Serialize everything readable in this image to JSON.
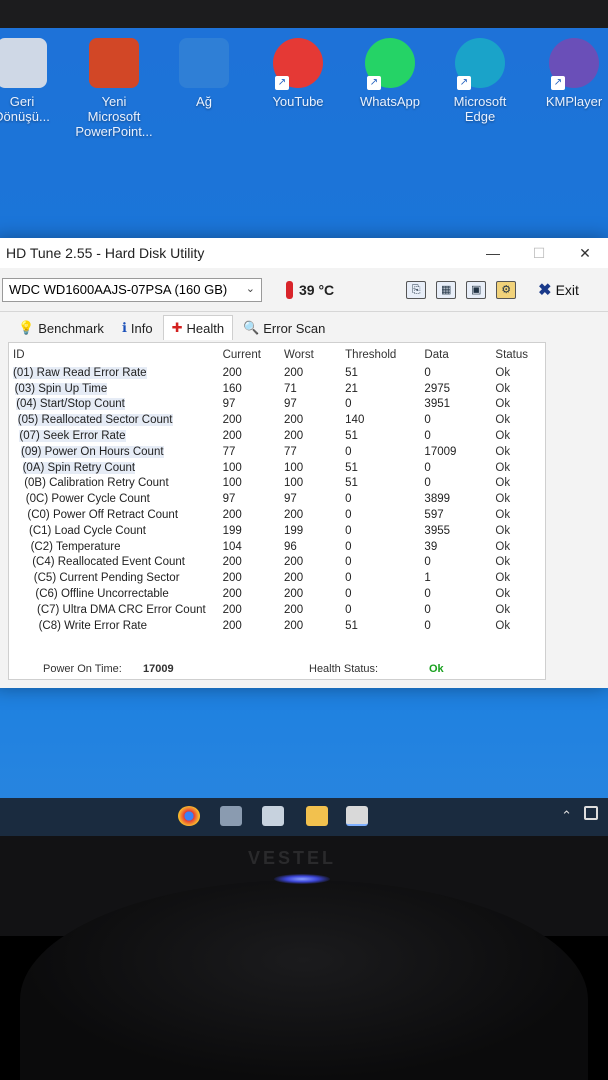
{
  "desktop_icons": [
    {
      "name": "recycle-bin",
      "label": "Geri\nDönüşü...",
      "color": "#cfd8e6"
    },
    {
      "name": "powerpoint-file",
      "label": "Yeni Microsoft\nPowerPoint...",
      "color": "#d24726"
    },
    {
      "name": "network",
      "label": "Ağ",
      "color": "#2f7fd6"
    },
    {
      "name": "youtube-shortcut",
      "label": "YouTube",
      "color": "#e53935"
    },
    {
      "name": "whatsapp-shortcut",
      "label": "WhatsApp",
      "color": "#25d366"
    },
    {
      "name": "edge-shortcut",
      "label": "Microsoft\nEdge",
      "color": "#1aa3c9"
    },
    {
      "name": "kmplayer-shortcut",
      "label": "KMPlayer",
      "color": "#6a4fb8"
    }
  ],
  "window": {
    "title": "HD Tune 2.55 - Hard Disk Utility",
    "minimize": "—",
    "maximize": "☐",
    "close": "✕"
  },
  "toolbar": {
    "drive": "WDC   WD1600AAJS-07PSA (160 GB)",
    "temperature": "39 °C",
    "exit_label": "Exit"
  },
  "tabs": [
    {
      "label": "Benchmark",
      "icon": "benchmark-icon"
    },
    {
      "label": "Info",
      "icon": "info-icon"
    },
    {
      "label": "Health",
      "icon": "health-icon",
      "active": true
    },
    {
      "label": "Error Scan",
      "icon": "error-scan-icon"
    }
  ],
  "table": {
    "headers": [
      "ID",
      "Current",
      "Worst",
      "Threshold",
      "Data",
      "Status"
    ],
    "rows": [
      [
        "(01) Raw Read Error Rate",
        "200",
        "200",
        "51",
        "0",
        "Ok"
      ],
      [
        "(03) Spin Up Time",
        "160",
        "71",
        "21",
        "2975",
        "Ok"
      ],
      [
        "(04) Start/Stop Count",
        "97",
        "97",
        "0",
        "3951",
        "Ok"
      ],
      [
        "(05) Reallocated Sector Count",
        "200",
        "200",
        "140",
        "0",
        "Ok"
      ],
      [
        "(07) Seek Error Rate",
        "200",
        "200",
        "51",
        "0",
        "Ok"
      ],
      [
        "(09) Power On Hours Count",
        "77",
        "77",
        "0",
        "17009",
        "Ok"
      ],
      [
        "(0A) Spin Retry Count",
        "100",
        "100",
        "51",
        "0",
        "Ok"
      ],
      [
        "(0B) Calibration Retry Count",
        "100",
        "100",
        "51",
        "0",
        "Ok"
      ],
      [
        "(0C) Power Cycle Count",
        "97",
        "97",
        "0",
        "3899",
        "Ok"
      ],
      [
        "(C0) Power Off Retract Count",
        "200",
        "200",
        "0",
        "597",
        "Ok"
      ],
      [
        "(C1) Load Cycle Count",
        "199",
        "199",
        "0",
        "3955",
        "Ok"
      ],
      [
        "(C2) Temperature",
        "104",
        "96",
        "0",
        "39",
        "Ok"
      ],
      [
        "(C4) Reallocated Event Count",
        "200",
        "200",
        "0",
        "0",
        "Ok"
      ],
      [
        "(C5) Current Pending Sector",
        "200",
        "200",
        "0",
        "1",
        "Ok"
      ],
      [
        "(C6) Offline Uncorrectable",
        "200",
        "200",
        "0",
        "0",
        "Ok"
      ],
      [
        "(C7) Ultra DMA CRC Error Count",
        "200",
        "200",
        "0",
        "0",
        "Ok"
      ],
      [
        "(C8) Write Error Rate",
        "200",
        "200",
        "51",
        "0",
        "Ok"
      ]
    ]
  },
  "footer": {
    "power_on_label": "Power On Time:",
    "power_on_value": "17009",
    "health_label": "Health Status:",
    "health_value": "Ok"
  },
  "colors": {
    "health_ok": "#18a01e",
    "desktop_blue": "#1977d9"
  }
}
